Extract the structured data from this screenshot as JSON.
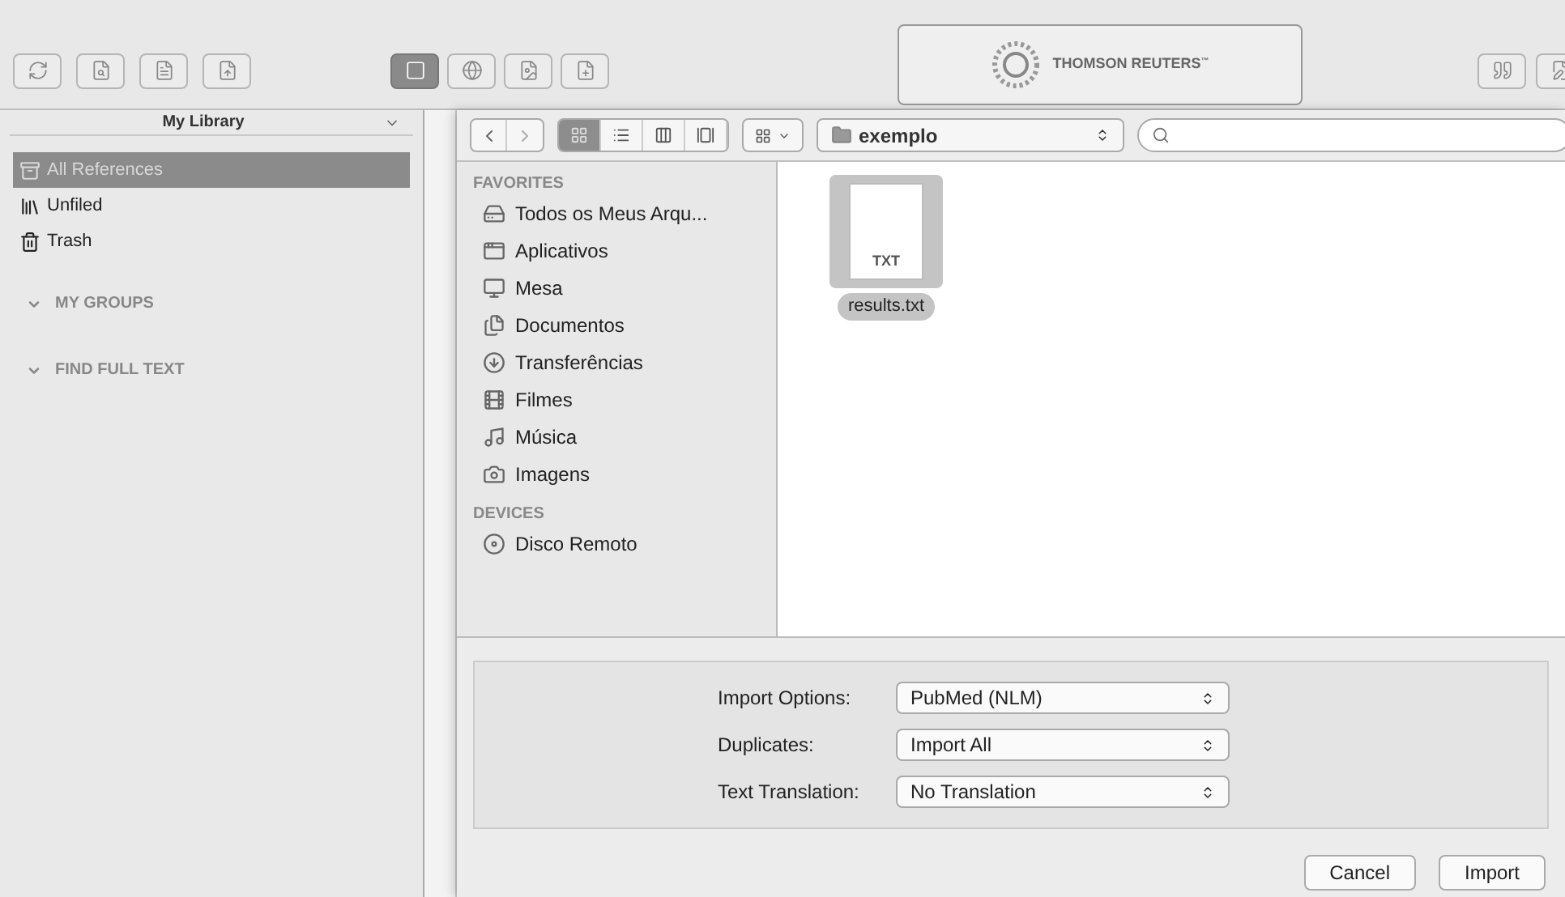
{
  "toolbar": {
    "logo_text": "THOMSON REUTERS",
    "logo_mark": "™",
    "view_buttons": [
      {
        "selected": true
      },
      {
        "selected": false
      },
      {
        "selected": false
      }
    ]
  },
  "library": {
    "title": "My Library",
    "items": [
      {
        "label": "All References",
        "selected": true,
        "kind": "all"
      },
      {
        "label": "Unfiled",
        "selected": false,
        "kind": "unfiled"
      },
      {
        "label": "Trash",
        "selected": false,
        "kind": "trash"
      }
    ],
    "groups": [
      {
        "label": "MY GROUPS",
        "expanded": true
      },
      {
        "label": "FIND FULL TEXT",
        "expanded": true
      }
    ]
  },
  "dialog": {
    "view_modes": [
      {
        "selected": true
      },
      {
        "selected": false
      },
      {
        "selected": false
      },
      {
        "selected": false
      }
    ],
    "folder": "exemplo",
    "sections": [
      {
        "title": "FAVORITES",
        "items": [
          {
            "label": "Todos os Meus Arqu...",
            "kind": "all"
          },
          {
            "label": "Aplicativos",
            "kind": "apps"
          },
          {
            "label": "Mesa",
            "kind": "desktop"
          },
          {
            "label": "Documentos",
            "kind": "docs"
          },
          {
            "label": "Transferências",
            "kind": "downloads"
          },
          {
            "label": "Filmes",
            "kind": "movies"
          },
          {
            "label": "Música",
            "kind": "music"
          },
          {
            "label": "Imagens",
            "kind": "pictures"
          }
        ]
      },
      {
        "title": "DEVICES",
        "items": [
          {
            "label": "Disco Remoto",
            "kind": "disc"
          }
        ]
      }
    ],
    "files": [
      {
        "name": "results.txt",
        "badge": "TXT",
        "selected": true
      }
    ],
    "options": [
      {
        "label": "Import Options:",
        "value": "PubMed (NLM)"
      },
      {
        "label": "Duplicates:",
        "value": "Import All"
      },
      {
        "label": "Text Translation:",
        "value": "No Translation"
      }
    ],
    "buttons": [
      "Cancel",
      "Import"
    ]
  }
}
